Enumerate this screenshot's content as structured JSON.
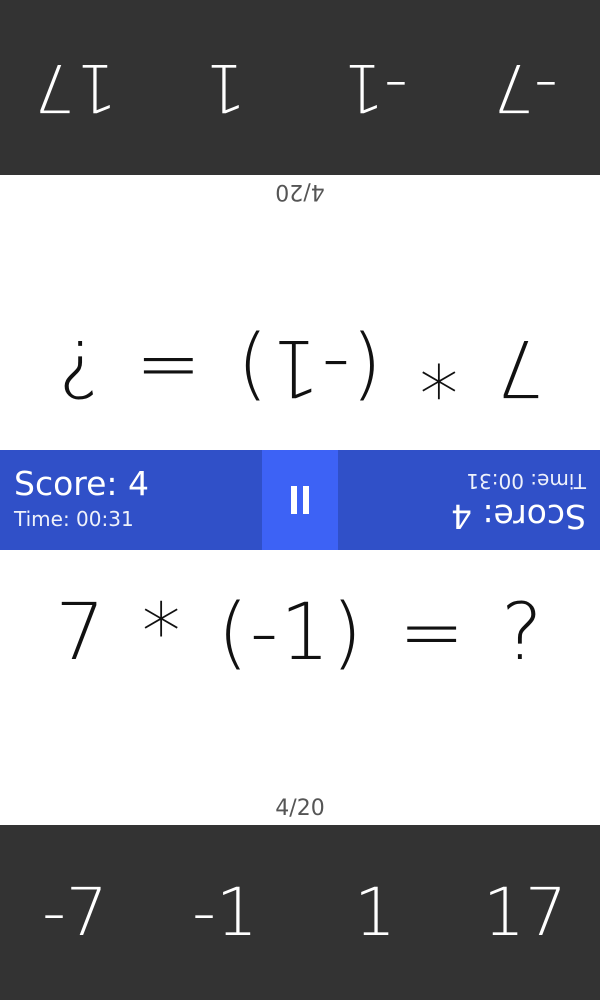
{
  "answers": [
    "-7",
    "-1",
    "1",
    "17"
  ],
  "question": {
    "equation": "7 * (-1) = ?",
    "progress": "4/20"
  },
  "status": {
    "score": "Score: 4",
    "time": "Time: 00:31"
  },
  "colors": {
    "answer_bar": "#333333",
    "status_bar": "#3050c8",
    "pause_button": "#3d62f5"
  },
  "icons": {
    "pause": "pause-icon"
  }
}
